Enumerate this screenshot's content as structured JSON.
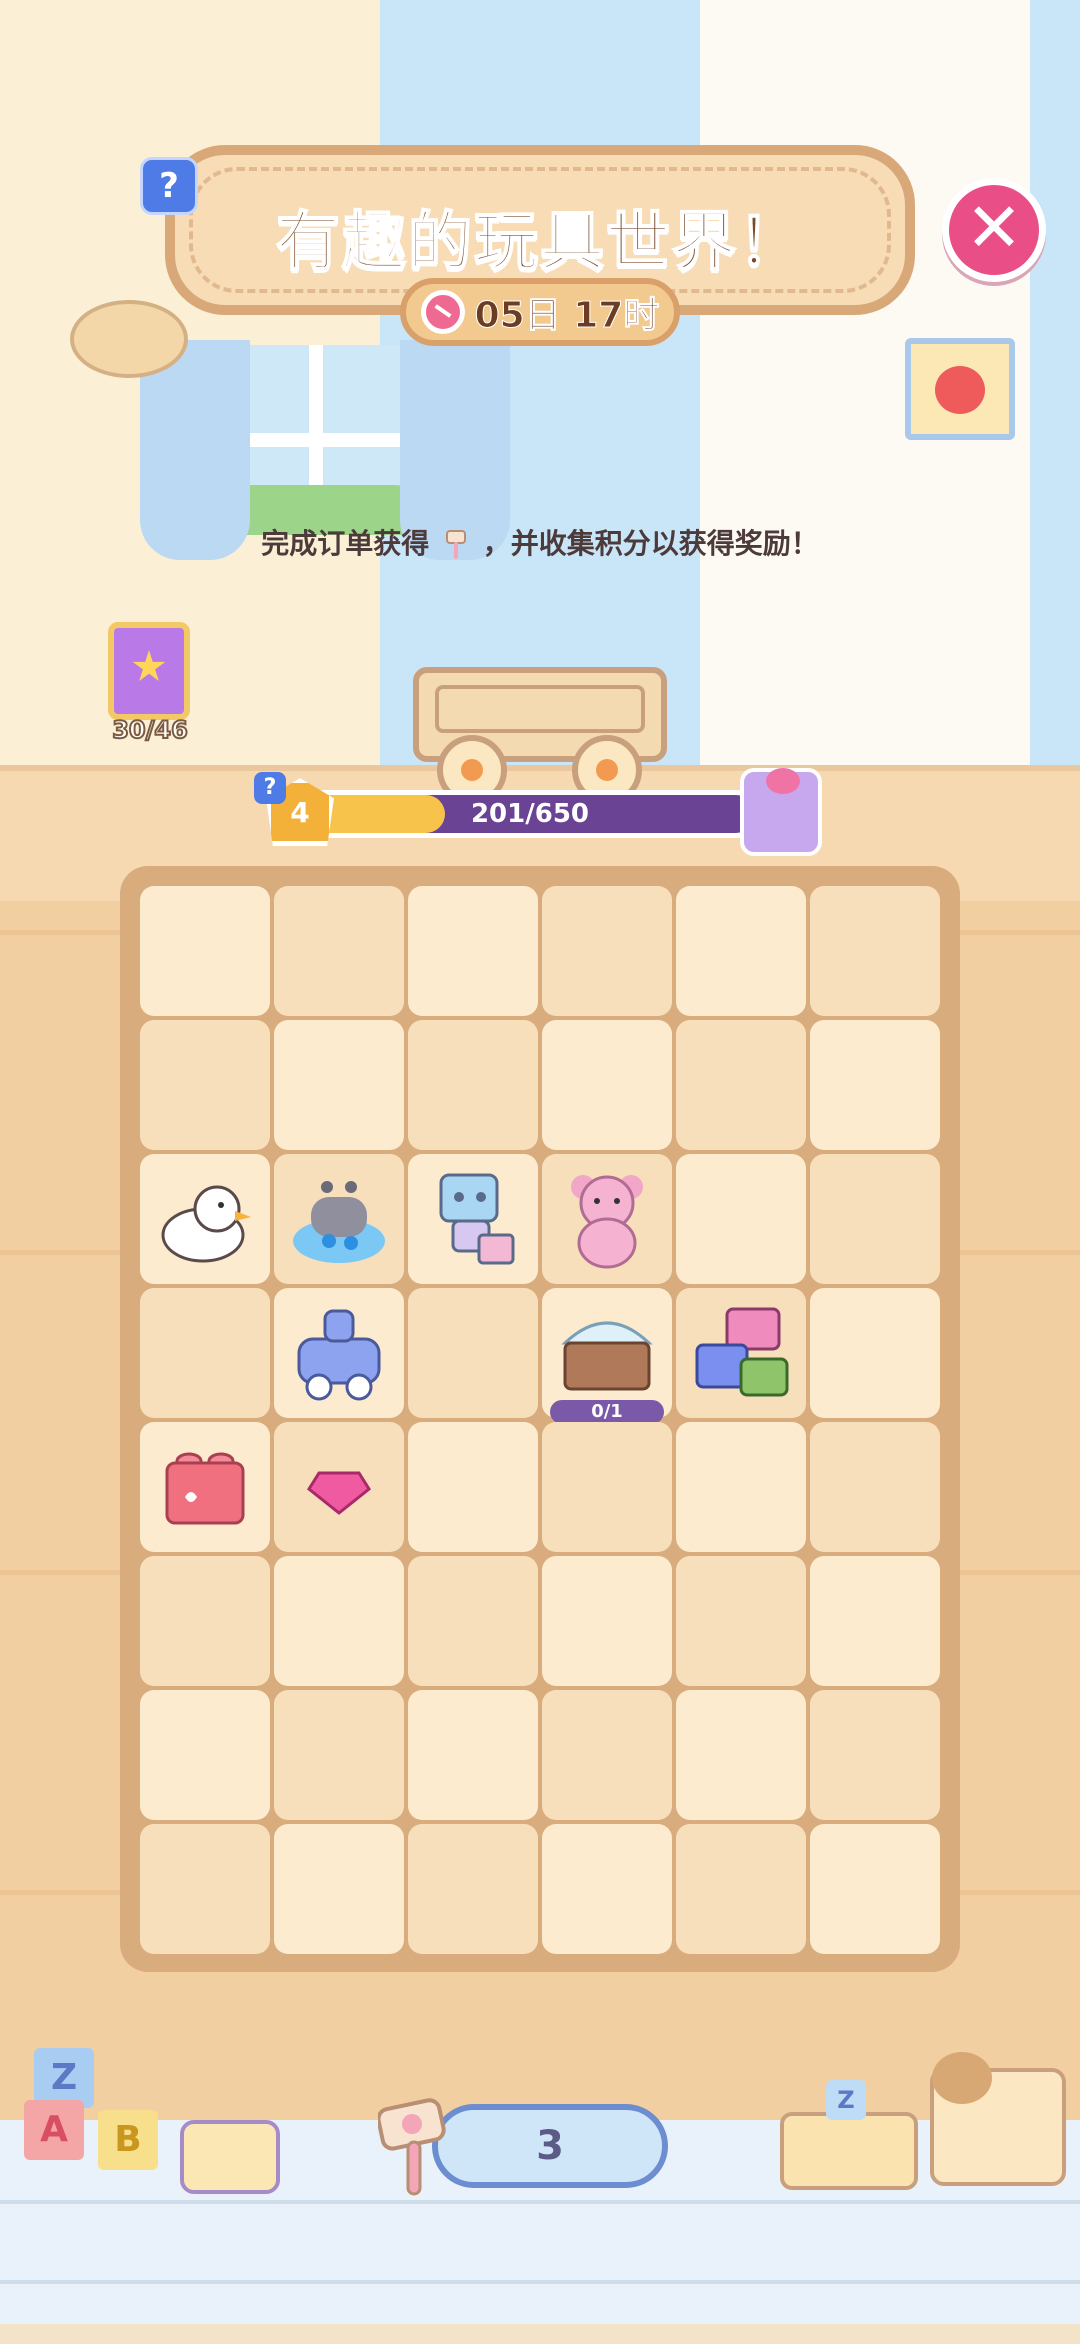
{
  "event": {
    "title": "有趣的玩具世界！",
    "timer": "05日 17时",
    "instruction_prefix": "完成订单获得",
    "instruction_suffix": "，并收集积分以获得奖励！",
    "help_label": "?",
    "close_label": "✕"
  },
  "album": {
    "count": "30/46"
  },
  "progress": {
    "level": "4",
    "text": "201/650",
    "current": 201,
    "max": 650,
    "help_label": "?"
  },
  "board": {
    "rows": 8,
    "cols": 6,
    "items": [
      {
        "row": 2,
        "col": 0,
        "name": "rubber-duck",
        "icon": "duck-icon"
      },
      {
        "row": 2,
        "col": 1,
        "name": "bath-toy",
        "icon": "bath-toy-icon"
      },
      {
        "row": 2,
        "col": 2,
        "name": "robot-toy",
        "icon": "robot-icon"
      },
      {
        "row": 2,
        "col": 3,
        "name": "teddy-bear",
        "icon": "teddy-bear-icon"
      },
      {
        "row": 3,
        "col": 1,
        "name": "toy-train",
        "icon": "train-icon"
      },
      {
        "row": 3,
        "col": 3,
        "name": "toy-chest",
        "icon": "chest-icon",
        "label": "0/1"
      },
      {
        "row": 3,
        "col": 4,
        "name": "building-blocks",
        "icon": "blocks-icon"
      },
      {
        "row": 4,
        "col": 0,
        "name": "red-brick",
        "icon": "brick-icon"
      },
      {
        "row": 4,
        "col": 1,
        "name": "pink-gem",
        "icon": "gem-icon"
      }
    ]
  },
  "toolbar": {
    "hammer_count": "3"
  },
  "decor": {
    "block_letters": [
      "Z",
      "A",
      "B"
    ],
    "cart_block_letter": "Z"
  },
  "colors": {
    "accent": "#e94f86",
    "progress_fill": "#f7c34a",
    "progress_track": "#6a4395"
  }
}
